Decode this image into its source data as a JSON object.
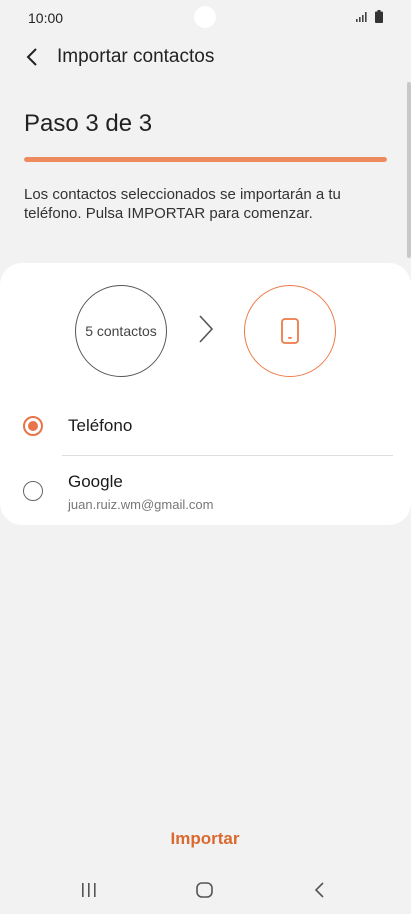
{
  "status_bar": {
    "time": "10:00",
    "icons": [
      "signal-icon",
      "battery-icon"
    ]
  },
  "header": {
    "back_icon": "chevron-left-icon",
    "title": "Importar contactos"
  },
  "step": {
    "title": "Paso 3 de 3",
    "progress": 1.0,
    "progress_color": "#ed8a5e"
  },
  "description": "Los contactos seleccionados se importarán a tu teléfono. Pulsa IMPORTAR para comenzar.",
  "transfer": {
    "source_label": "5 contactos",
    "arrow_icon": "chevron-right-icon",
    "destination_icon": "phone-icon"
  },
  "options": [
    {
      "label": "Teléfono",
      "sublabel": "",
      "selected": true
    },
    {
      "label": "Google",
      "sublabel": "juan.ruiz.wm@gmail.com",
      "selected": false
    }
  ],
  "import_button": "Importar",
  "accent_color": "#e8744a",
  "nav_bar": {
    "icons": [
      "recent-apps-icon",
      "home-icon",
      "back-icon"
    ]
  }
}
